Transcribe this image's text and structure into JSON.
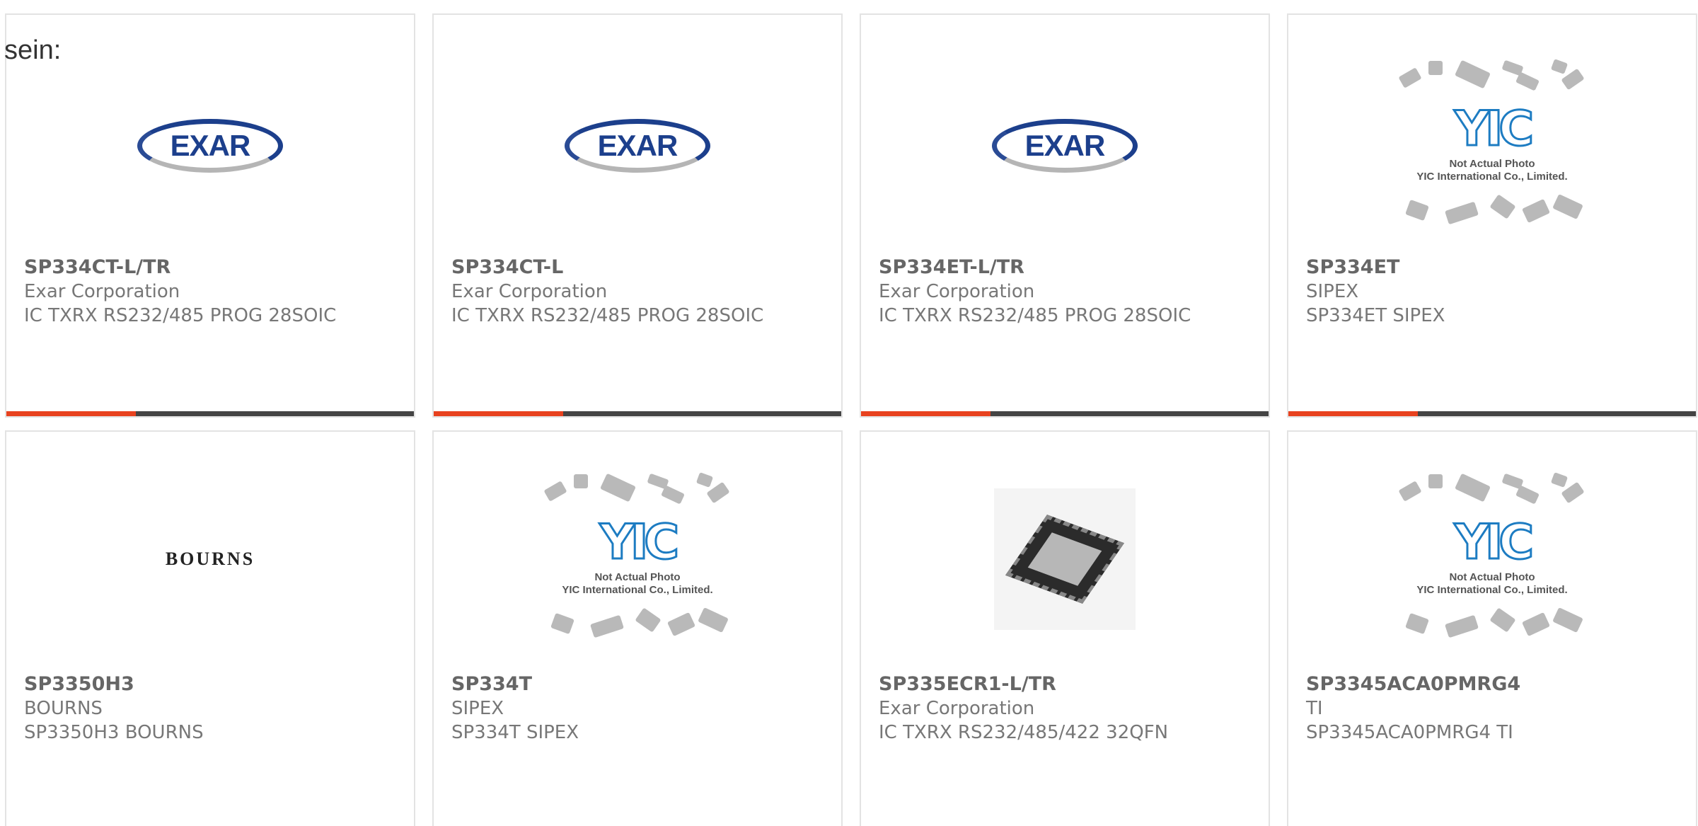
{
  "intro_text": "sein:",
  "cards": [
    {
      "part": "SP334CT-L/TR",
      "manufacturer": "Exar Corporation",
      "description": "IC TXRX RS232/485 PROG 28SOIC",
      "image": "exar-logo"
    },
    {
      "part": "SP334CT-L",
      "manufacturer": "Exar Corporation",
      "description": "IC TXRX RS232/485 PROG 28SOIC",
      "image": "exar-logo"
    },
    {
      "part": "SP334ET-L/TR",
      "manufacturer": "Exar Corporation",
      "description": "IC TXRX RS232/485 PROG 28SOIC",
      "image": "exar-logo"
    },
    {
      "part": "SP334ET",
      "manufacturer": "SIPEX",
      "description": "SP334ET SIPEX",
      "image": "yic-placeholder"
    },
    {
      "part": "SP3350H3",
      "manufacturer": "BOURNS",
      "description": "SP3350H3 BOURNS",
      "image": "bourns-logo"
    },
    {
      "part": "SP334T",
      "manufacturer": "SIPEX",
      "description": "SP334T SIPEX",
      "image": "yic-placeholder"
    },
    {
      "part": "SP335ECR1-L/TR",
      "manufacturer": "Exar Corporation",
      "description": "IC TXRX RS232/485/422 32QFN",
      "image": "qfn-chip-photo"
    },
    {
      "part": "SP3345ACA0PMRG4",
      "manufacturer": "TI",
      "description": "SP3345ACA0PMRG4 TI",
      "image": "yic-placeholder"
    }
  ],
  "logos": {
    "exar": "EXAR",
    "bourns": "BOURNS",
    "yic": "YIC",
    "yic_caption_1": "Not Actual Photo",
    "yic_caption_2": "YIC International Co., Limited."
  },
  "colors": {
    "accent": "#e8421f",
    "bar": "#444444",
    "border": "#e3e3e3",
    "exar_blue": "#1c3f8c",
    "yic_blue": "#1d7cc2"
  }
}
